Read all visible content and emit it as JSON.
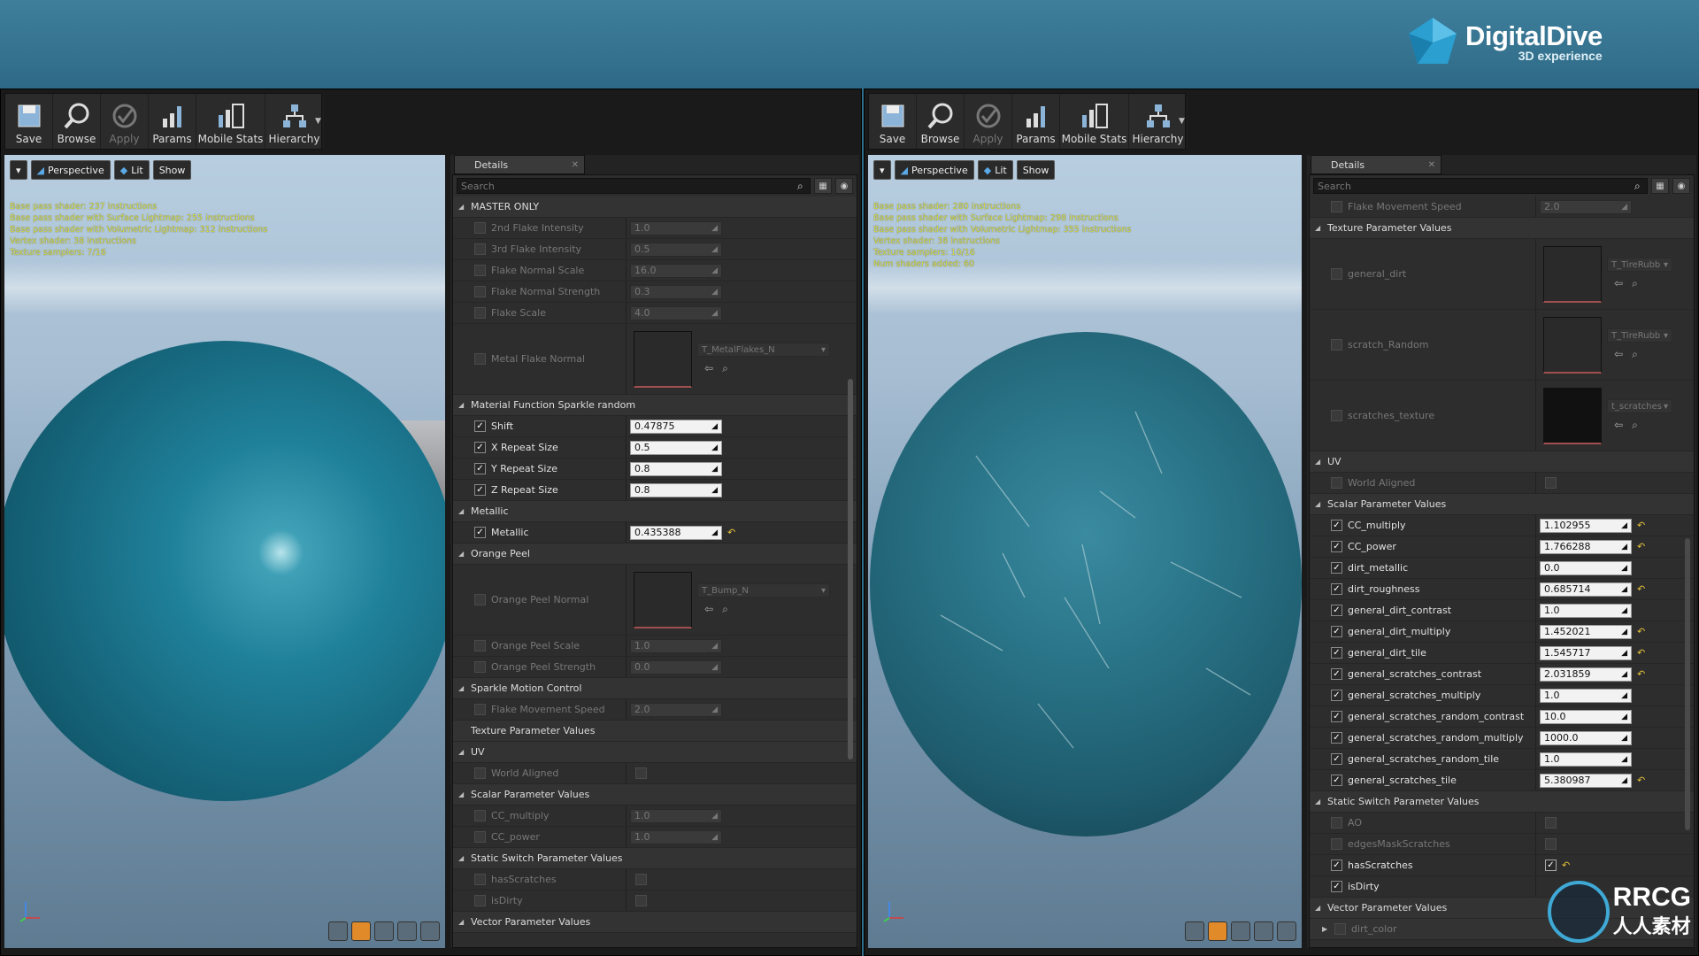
{
  "brand": {
    "title": "DigitalDive",
    "subtitle": "3D experience"
  },
  "toolbar": {
    "buttons": [
      {
        "label": "Save",
        "icon": "save-icon"
      },
      {
        "label": "Browse",
        "icon": "browse-icon"
      },
      {
        "label": "Apply",
        "icon": "apply-icon",
        "disabled": true
      },
      {
        "label": "Params",
        "icon": "params-icon"
      },
      {
        "label": "Mobile Stats",
        "icon": "mobile-stats-icon"
      },
      {
        "label": "Hierarchy",
        "icon": "hierarchy-icon"
      }
    ]
  },
  "viewport": {
    "perspective": "Perspective",
    "lit": "Lit",
    "show": "Show"
  },
  "left": {
    "stats": [
      "Base pass shader: 237 instructions",
      "Base pass shader with Surface Lightmap: 255 instructions",
      "Base pass shader with Volumetric Lightmap: 312 instructions",
      "Vertex shader: 38 instructions",
      "Texture samplers: 7/16"
    ],
    "details_tab": "Details",
    "search_placeholder": "Search",
    "rows": [
      {
        "kind": "cat",
        "label": "MASTER ONLY"
      },
      {
        "kind": "num",
        "label": "2nd Flake Intensity",
        "value": "1.0",
        "on": false
      },
      {
        "kind": "num",
        "label": "3rd Flake Intensity",
        "value": "0.5",
        "on": false
      },
      {
        "kind": "num",
        "label": "Flake Normal Scale",
        "value": "16.0",
        "on": false
      },
      {
        "kind": "num",
        "label": "Flake Normal Strength",
        "value": "0.3",
        "on": false
      },
      {
        "kind": "num",
        "label": "Flake Scale",
        "value": "4.0",
        "on": false
      },
      {
        "kind": "tex",
        "label": "Metal Flake Normal",
        "value": "T_MetalFlakes_N"
      },
      {
        "kind": "cat",
        "label": "Material Function Sparkle random"
      },
      {
        "kind": "num",
        "label": "Shift",
        "value": "0.47875",
        "on": true
      },
      {
        "kind": "num",
        "label": "X Repeat Size",
        "value": "0.5",
        "on": true
      },
      {
        "kind": "num",
        "label": "Y Repeat Size",
        "value": "0.8",
        "on": true
      },
      {
        "kind": "num",
        "label": "Z Repeat Size",
        "value": "0.8",
        "on": true
      },
      {
        "kind": "cat",
        "label": "Metallic"
      },
      {
        "kind": "num",
        "label": "Metallic",
        "value": "0.435388",
        "on": true,
        "reset": true
      },
      {
        "kind": "cat",
        "label": "Orange Peel"
      },
      {
        "kind": "tex",
        "label": "Orange Peel Normal",
        "value": "T_Bump_N"
      },
      {
        "kind": "num",
        "label": "Orange Peel Scale",
        "value": "1.0",
        "on": false
      },
      {
        "kind": "num",
        "label": "Orange Peel Strength",
        "value": "0.0",
        "on": false
      },
      {
        "kind": "cat",
        "label": "Sparkle Motion Control"
      },
      {
        "kind": "num",
        "label": "Flake Movement Speed",
        "value": "2.0",
        "on": false
      },
      {
        "kind": "cat",
        "label": "Texture Parameter Values",
        "notri": true
      },
      {
        "kind": "cat",
        "label": "UV"
      },
      {
        "kind": "bool",
        "label": "World Aligned",
        "checked": false
      },
      {
        "kind": "cat",
        "label": "Scalar Parameter Values"
      },
      {
        "kind": "num",
        "label": "CC_multiply",
        "value": "1.0",
        "on": false
      },
      {
        "kind": "num",
        "label": "CC_power",
        "value": "1.0",
        "on": false
      },
      {
        "kind": "cat",
        "label": "Static Switch Parameter Values"
      },
      {
        "kind": "bool",
        "label": "hasScratches",
        "checked": false
      },
      {
        "kind": "bool",
        "label": "isDirty",
        "checked": false
      },
      {
        "kind": "cat",
        "label": "Vector Parameter Values"
      }
    ]
  },
  "right": {
    "stats": [
      "Base pass shader: 280 instructions",
      "Base pass shader with Surface Lightmap: 298 instructions",
      "Base pass shader with Volumetric Lightmap: 355 instructions",
      "Vertex shader: 38 instructions",
      "Texture samplers: 10/16",
      "Num shaders added: 60"
    ],
    "details_tab": "Details",
    "search_placeholder": "Search",
    "rows": [
      {
        "kind": "num",
        "label": "Flake Movement Speed",
        "value": "2.0",
        "on": false
      },
      {
        "kind": "cat",
        "label": "Texture Parameter Values"
      },
      {
        "kind": "tex",
        "label": "general_dirt",
        "value": "T_TireRubb"
      },
      {
        "kind": "tex",
        "label": "scratch_Random",
        "value": "T_TireRubb"
      },
      {
        "kind": "tex",
        "label": "scratches_texture",
        "value": "t_scratches",
        "dark": true
      },
      {
        "kind": "cat",
        "label": "UV"
      },
      {
        "kind": "bool",
        "label": "World Aligned",
        "checked": false
      },
      {
        "kind": "cat",
        "label": "Scalar Parameter Values"
      },
      {
        "kind": "num",
        "label": "CC_multiply",
        "value": "1.102955",
        "on": true,
        "reset": true
      },
      {
        "kind": "num",
        "label": "CC_power",
        "value": "1.766288",
        "on": true,
        "reset": true
      },
      {
        "kind": "num",
        "label": "dirt_metallic",
        "value": "0.0",
        "on": true
      },
      {
        "kind": "num",
        "label": "dirt_roughness",
        "value": "0.685714",
        "on": true,
        "reset": true
      },
      {
        "kind": "num",
        "label": "general_dirt_contrast",
        "value": "1.0",
        "on": true
      },
      {
        "kind": "num",
        "label": "general_dirt_multiply",
        "value": "1.452021",
        "on": true,
        "reset": true
      },
      {
        "kind": "num",
        "label": "general_dirt_tile",
        "value": "1.545717",
        "on": true,
        "reset": true
      },
      {
        "kind": "num",
        "label": "general_scratches_contrast",
        "value": "2.031859",
        "on": true,
        "reset": true
      },
      {
        "kind": "num",
        "label": "general_scratches_multiply",
        "value": "1.0",
        "on": true
      },
      {
        "kind": "num",
        "label": "general_scratches_random_contrast",
        "value": "10.0",
        "on": true
      },
      {
        "kind": "num",
        "label": "general_scratches_random_multiply",
        "value": "1000.0",
        "on": true
      },
      {
        "kind": "num",
        "label": "general_scratches_random_tile",
        "value": "1.0",
        "on": true
      },
      {
        "kind": "num",
        "label": "general_scratches_tile",
        "value": "5.380987",
        "on": true,
        "reset": true
      },
      {
        "kind": "cat",
        "label": "Static Switch Parameter Values"
      },
      {
        "kind": "bool",
        "label": "AO",
        "checked": false
      },
      {
        "kind": "bool",
        "label": "edgesMaskScratches",
        "checked": false
      },
      {
        "kind": "bool",
        "label": "hasScratches",
        "checked": true,
        "on": true,
        "reset": true
      },
      {
        "kind": "bool",
        "label": "isDirty",
        "checked": false,
        "on": true,
        "nobox": true
      },
      {
        "kind": "cat",
        "label": "Vector Parameter Values"
      },
      {
        "kind": "sub",
        "label": "dirt_color"
      }
    ]
  },
  "watermark": {
    "title": "RRCG",
    "subtitle": "人人素材"
  }
}
